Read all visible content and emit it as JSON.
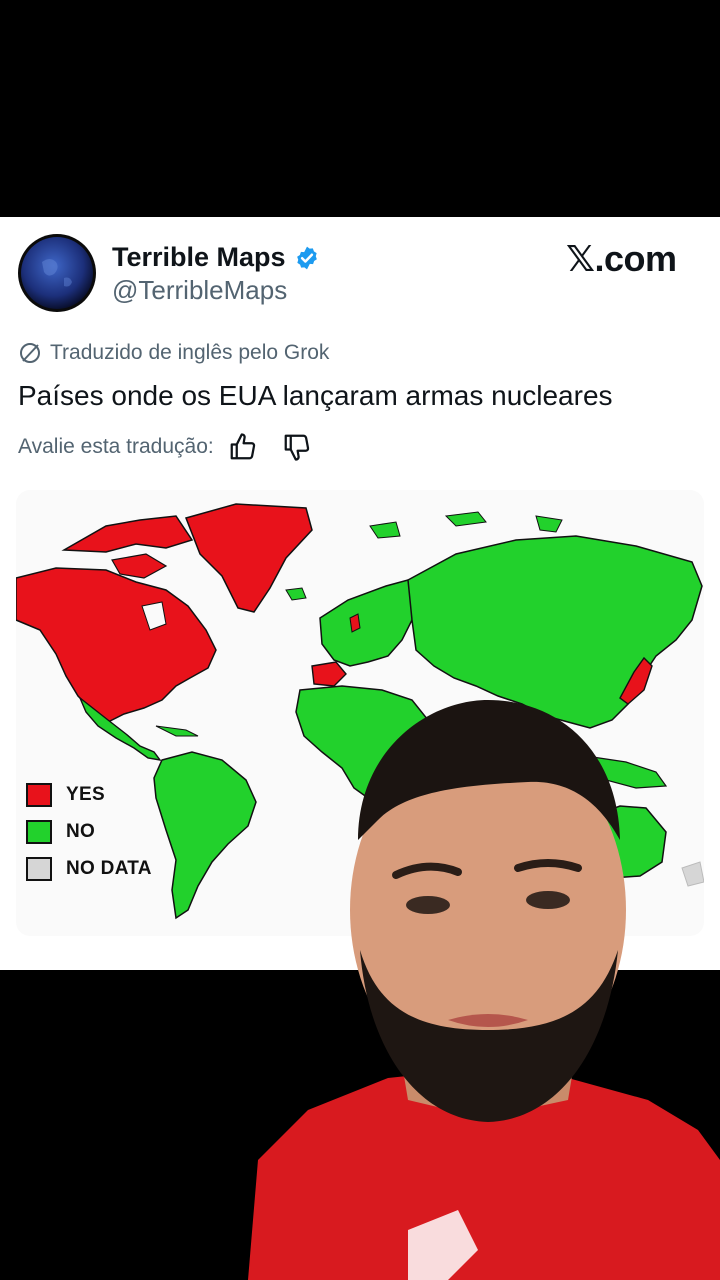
{
  "post": {
    "display_name": "Terrible Maps",
    "handle": "@TerribleMaps",
    "watermark": "𝕏.com",
    "translation_notice": "Traduzido de inglês pelo Grok",
    "text": "Países onde os EUA lançaram armas nucleares",
    "rate_prompt": "Avalie esta tradução:",
    "icons": {
      "verified": "verified-badge-icon",
      "translate": "translate-icon",
      "thumbs_up": "thumbs-up-icon",
      "thumbs_down": "thumbs-down-icon"
    }
  },
  "map": {
    "legend": [
      {
        "label": "YES",
        "color": "#e8121b"
      },
      {
        "label": "NO",
        "color": "#22d12c"
      },
      {
        "label": "NO DATA",
        "color": "#d6d6d6"
      }
    ]
  },
  "colors": {
    "background": "#000000",
    "card": "#ffffff",
    "verified": "#1d9bf0",
    "muted_text": "#536471",
    "shirt": "#d81a1f"
  }
}
